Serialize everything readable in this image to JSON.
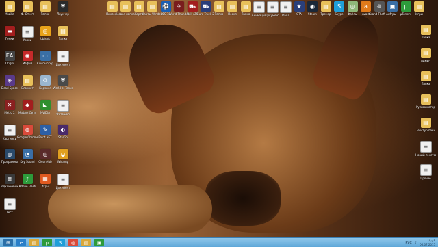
{
  "icons": [
    {
      "label": "Пиксели",
      "color": "#e8c05a",
      "glyph": "▤"
    },
    {
      "label": "Новая папка",
      "color": "#e8c05a",
      "glyph": "▤"
    },
    {
      "label": "Карта",
      "color": "#e8c05a",
      "glyph": "▤"
    },
    {
      "label": "Карты Windows",
      "color": "#e8c05a",
      "glyph": "▤"
    },
    {
      "label": "PES 18",
      "color": "#1b5fb3",
      "glyph": "⚽"
    },
    {
      "label": "World Thunder",
      "color": "#7a1d1d",
      "glyph": "✈"
    },
    {
      "label": "Skill ATS",
      "color": "#a31e1e",
      "glyph": "⛟"
    },
    {
      "label": "Euro Truck 2",
      "color": "#2a3f7a",
      "glyph": "⛟"
    },
    {
      "label": "Папка",
      "color": "#e8c05a",
      "glyph": "▤"
    },
    {
      "label": "Песня",
      "color": "#e8c05a",
      "glyph": "▤"
    },
    {
      "label": "Папка",
      "color": "#e8c05a",
      "glyph": "▤"
    },
    {
      "label": "Анимация",
      "color": "#f0f0f0",
      "glyph": "≡"
    },
    {
      "label": "Документ",
      "color": "#f0f0f0",
      "glyph": "≡"
    },
    {
      "label": "Файл",
      "color": "#f0f0f0",
      "glyph": "≡"
    },
    {
      "label": "GTA",
      "color": "#2a3f7a",
      "glyph": "★"
    },
    {
      "label": "Steam",
      "color": "#1b2838",
      "glyph": "◉"
    },
    {
      "label": "Тренер",
      "color": "#e8c05a",
      "glyph": "▤"
    },
    {
      "label": "Skype",
      "color": "#1f9ed8",
      "glyph": "S"
    },
    {
      "label": "Файлы",
      "color": "#8fb77a",
      "glyph": "◎"
    },
    {
      "label": "Avast",
      "color": "#e07a1a",
      "glyph": "a"
    },
    {
      "label": "Grand Theft Auto",
      "color": "#555555",
      "glyph": "☠"
    },
    {
      "label": "Игры",
      "color": "#3a6fa5",
      "glyph": "▣"
    },
    {
      "label": "µTorrent",
      "color": "#2d9b3b",
      "glyph": "µ"
    },
    {
      "label": "Игры",
      "color": "#e8c05a",
      "glyph": "▤"
    }
  ],
  "left_icons": [
    {
      "label": "Mozilla",
      "color": "#e8c05a",
      "glyph": "▤"
    },
    {
      "label": "Ф. Отчет",
      "color": "#e8c05a",
      "glyph": "▤"
    },
    {
      "label": "Папка",
      "color": "#e8c05a",
      "glyph": "▤"
    },
    {
      "label": "Лаунчер",
      "color": "#2b2b2b",
      "glyph": "⛨"
    },
    {
      "label": "Гонки",
      "color": "#a31e1e",
      "glyph": "▬"
    },
    {
      "label": "Уроки",
      "color": "#f0f0f0",
      "glyph": "≡"
    },
    {
      "label": "Ubisoft",
      "color": "#e8a21a",
      "glyph": "◎"
    },
    {
      "label": "Папка",
      "color": "#e8c05a",
      "glyph": "▤"
    },
    {
      "label": "Origin",
      "color": "#444444",
      "glyph": "EA"
    },
    {
      "label": "Мафия",
      "color": "#c72a2a",
      "glyph": "◉"
    },
    {
      "label": "Компьютер",
      "color": "#3a6fa5",
      "glyph": "▭"
    },
    {
      "label": "Документ",
      "color": "#f0f0f0",
      "glyph": "≡"
    },
    {
      "label": "Dead Space",
      "color": "#5a3a8a",
      "glyph": "◈"
    },
    {
      "label": "Блокнот",
      "color": "#e8c05a",
      "glyph": "▤"
    },
    {
      "label": "Корзина",
      "color": "#9ab6cf",
      "glyph": "♻"
    },
    {
      "label": "World of Tanks",
      "color": "#4a4a4a",
      "glyph": "⛨"
    },
    {
      "label": "Metro 2",
      "color": "#8a2020",
      "glyph": "✕"
    },
    {
      "label": "Мафия Сити",
      "color": "#a31e1e",
      "glyph": "◆"
    },
    {
      "label": "NVIDIA",
      "color": "#2f8f2f",
      "glyph": "◣"
    },
    {
      "label": "Фотошоп",
      "color": "#f0f0f0",
      "glyph": "≡"
    },
    {
      "label": "Картинки",
      "color": "#f0f0f0",
      "glyph": "≡"
    },
    {
      "label": "Google Chrome",
      "color": "#d94a3a",
      "glyph": "◍"
    },
    {
      "label": "Paint.NET",
      "color": "#2d5fa5",
      "glyph": "✎"
    },
    {
      "label": "StarGo",
      "color": "#4a2a6a",
      "glyph": "◐"
    },
    {
      "label": "Программы",
      "color": "#2a4a6a",
      "glyph": "◍"
    },
    {
      "label": "Key Sound",
      "color": "#3a6fa5",
      "glyph": "◔"
    },
    {
      "label": "CleanHub",
      "color": "#5a2a2a",
      "glyph": "◎"
    },
    {
      "label": "Winamp",
      "color": "#e0a020",
      "glyph": "◒"
    },
    {
      "label": "Подключен к Интернету",
      "color": "#3a3a3a",
      "glyph": "≣"
    },
    {
      "label": "Adobe Flash",
      "color": "#2d9b3b",
      "glyph": "ƒ"
    },
    {
      "label": "Игры",
      "color": "#e05a20",
      "glyph": "▦"
    },
    {
      "label": "Документ",
      "color": "#f0f0f0",
      "glyph": "≡"
    },
    {
      "label": "Тест",
      "color": "#f0f0f0",
      "glyph": "≡"
    }
  ],
  "right_icons": [
    {
      "label": "Папка",
      "color": "#e8c05a",
      "glyph": "▤"
    },
    {
      "label": "Админ",
      "color": "#e8c05a",
      "glyph": "▤"
    },
    {
      "label": "Папка",
      "color": "#e8c05a",
      "glyph": "▤"
    },
    {
      "label": "Русификатор",
      "color": "#e8c05a",
      "glyph": "▤"
    },
    {
      "label": "Текстур паки",
      "color": "#e8c05a",
      "glyph": "▤"
    },
    {
      "label": "Новый текстовый",
      "color": "#f0f0f0",
      "glyph": "≡"
    },
    {
      "label": "Прочее",
      "color": "#f0f0f0",
      "glyph": "≡"
    }
  ],
  "taskbar": {
    "buttons": [
      {
        "name": "start-button",
        "glyph": "⊞",
        "color": "#2a6fa8"
      },
      {
        "name": "ie-button",
        "glyph": "e",
        "color": "#2a7fc8"
      },
      {
        "name": "folder-button",
        "glyph": "▤",
        "color": "#d9a83a"
      },
      {
        "name": "utorrent-button",
        "glyph": "µ",
        "color": "#2d9b3b"
      },
      {
        "name": "skype-button",
        "glyph": "S",
        "color": "#1f9ed8"
      },
      {
        "name": "chrome-button",
        "glyph": "◍",
        "color": "#d94a3a"
      },
      {
        "name": "explorer-button",
        "glyph": "▤",
        "color": "#d9a83a"
      },
      {
        "name": "app-button",
        "glyph": "▣",
        "color": "#2d9b3b"
      }
    ],
    "lang": "РУС",
    "time": "15:45",
    "date": "06.07.2015"
  }
}
